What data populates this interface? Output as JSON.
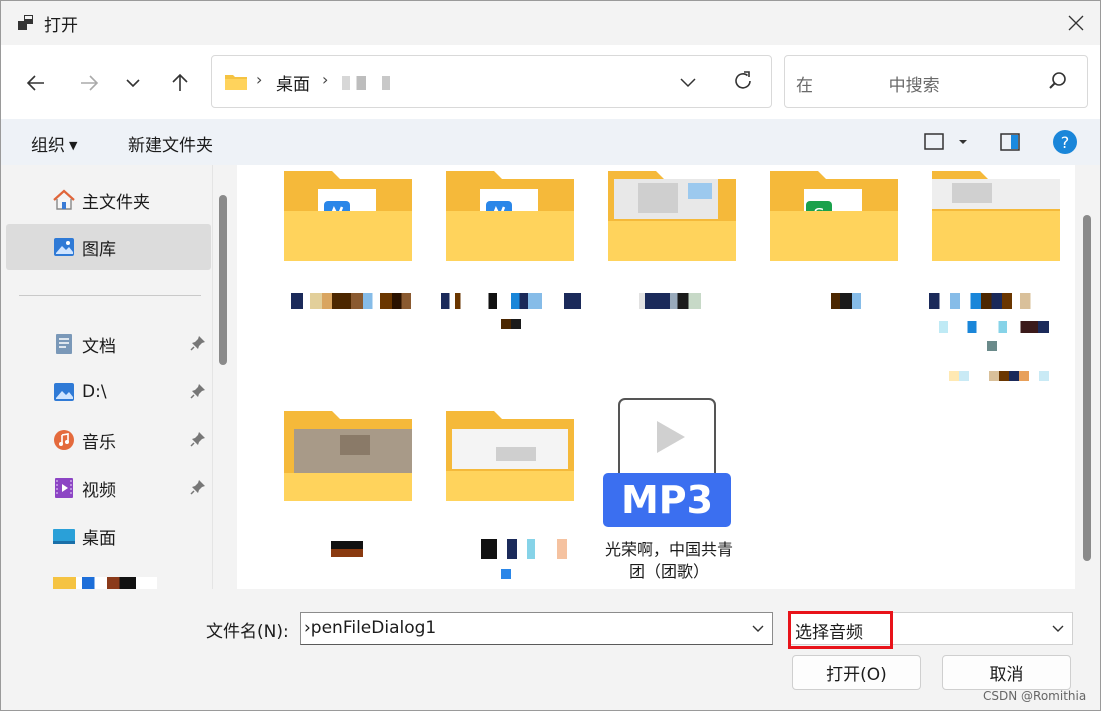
{
  "window": {
    "title": "打开"
  },
  "address": {
    "crumbs": [
      "桌面"
    ],
    "separator": "›"
  },
  "search": {
    "placeholder": "在              中搜索"
  },
  "toolbar": {
    "organize": "组织",
    "new_folder": "新建文件夹"
  },
  "sidebar": {
    "items": [
      {
        "label": "主文件夹",
        "icon": "home-icon",
        "pinned": false,
        "selected": false
      },
      {
        "label": "图库",
        "icon": "gallery-icon",
        "pinned": false,
        "selected": true
      },
      {
        "label": "文档",
        "icon": "document-icon",
        "pinned": true,
        "selected": false
      },
      {
        "label": "D:\\",
        "icon": "drive-icon",
        "pinned": true,
        "selected": false
      },
      {
        "label": "音乐",
        "icon": "music-icon",
        "pinned": true,
        "selected": false
      },
      {
        "label": "视频",
        "icon": "video-icon",
        "pinned": true,
        "selected": false
      },
      {
        "label": "桌面",
        "icon": "desktop-icon",
        "pinned": false,
        "selected": false
      }
    ]
  },
  "files": {
    "mp3_badge": "MP3",
    "mp3_name": "光荣啊，中国共青团（团歌）"
  },
  "footer": {
    "filename_label": "文件名(N):",
    "filename_value": "›penFileDialog1",
    "filter_value": "选择音频",
    "open_button": "打开(O)",
    "cancel_button": "取消"
  },
  "watermark": "CSDN @Romithia",
  "colors": {
    "accent": "#0067c0",
    "folder": "#f5c342",
    "mp3_badge": "#3b6ff0",
    "highlight": "#e8131a"
  }
}
